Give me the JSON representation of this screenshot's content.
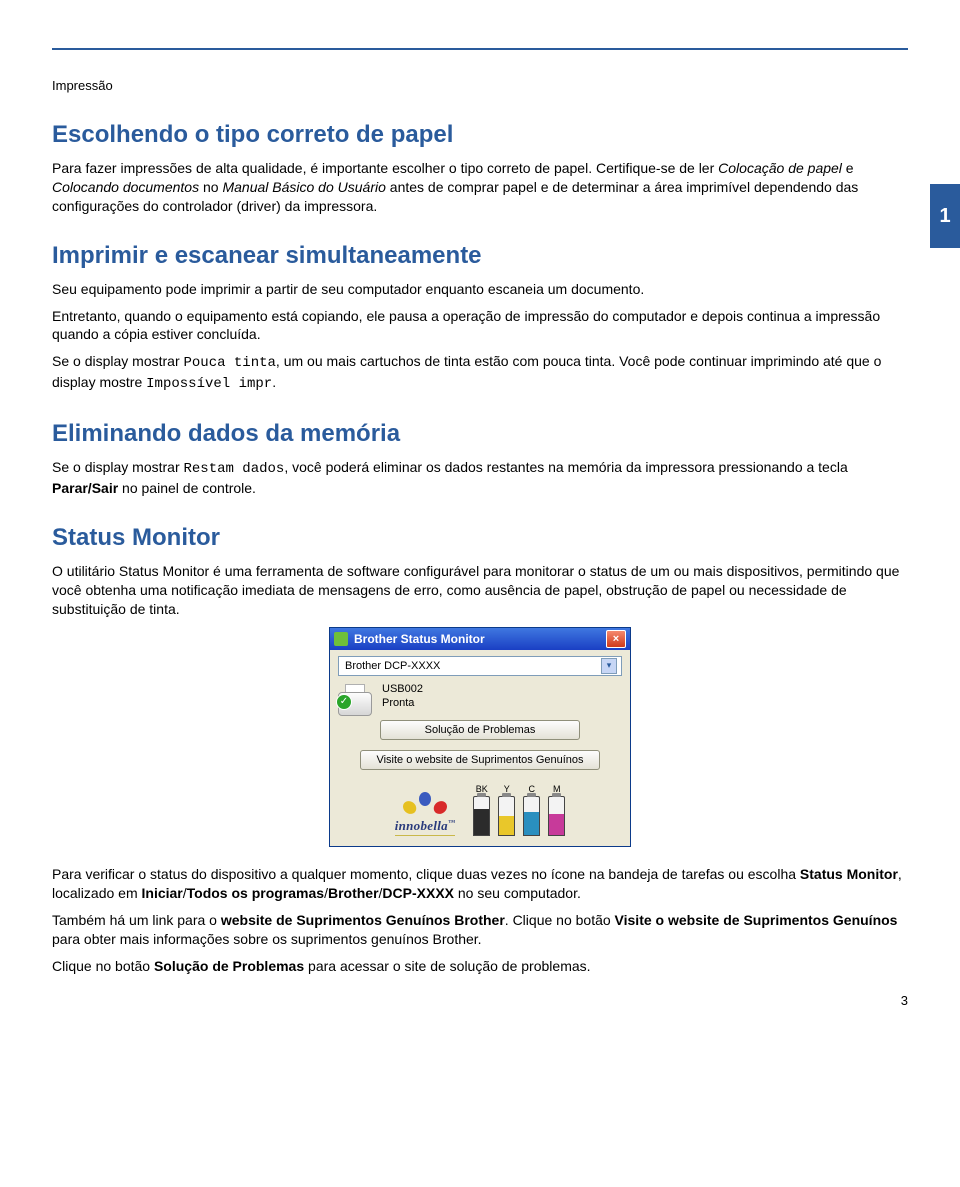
{
  "page": {
    "breadcrumb": "Impressão",
    "chapter_tab": "1",
    "page_number": "3"
  },
  "h1": "Escolhendo o tipo correto de papel",
  "p1a": "Para fazer impressões de alta qualidade, é importante escolher o tipo correto de papel. Certifique-se de ler ",
  "p1b": "Colocação de papel",
  "p1c": " e ",
  "p1d": "Colocando documentos",
  "p1e": " no ",
  "p1f": "Manual Básico do Usuário",
  "p1g": " antes de comprar papel e de determinar a área imprimível dependendo das configurações do controlador (driver) da impressora.",
  "h2": "Imprimir e escanear simultaneamente",
  "p2": "Seu equipamento pode imprimir a partir de seu computador enquanto escaneia um documento.",
  "p3": "Entretanto, quando o equipamento está copiando, ele pausa a operação de impressão do computador e depois continua a impressão quando a cópia estiver concluída.",
  "p4a": "Se o display mostrar ",
  "p4b": "Pouca tinta",
  "p4c": ", um ou mais cartuchos de tinta estão com pouca tinta. Você pode continuar imprimindo até que o display mostre ",
  "p4d": "Impossível impr",
  "p4e": ".",
  "h3": "Eliminando dados da memória",
  "p5a": "Se o display mostrar ",
  "p5b": "Restam dados",
  "p5c": ", você poderá eliminar os dados restantes na memória da impressora pressionando a tecla ",
  "p5d": "Parar/Sair",
  "p5e": " no painel de controle.",
  "h4": "Status Monitor",
  "p6": "O utilitário Status Monitor é uma ferramenta de software configurável para monitorar o status de um ou mais dispositivos, permitindo que você obtenha uma notificação imediata de mensagens de erro, como ausência de papel, obstrução de papel ou necessidade de substituição de tinta.",
  "p7a": "Para verificar o status do dispositivo a qualquer momento, clique duas vezes no ícone na bandeja de tarefas ou escolha ",
  "p7b": "Status Monitor",
  "p7c": ", localizado em ",
  "p7d": "Iniciar",
  "p7e": "/",
  "p7f": "Todos os programas",
  "p7g": "/",
  "p7h": "Brother",
  "p7i": "/",
  "p7j": "DCP-XXXX",
  "p7k": " no seu computador.",
  "p8a": "Também há um link para o ",
  "p8b": "website de Suprimentos Genuínos Brother",
  "p8c": ". Clique no botão ",
  "p8d": "Visite o website de Suprimentos Genuínos",
  "p8e": " para obter mais informações sobre os suprimentos genuínos Brother.",
  "p9a": "Clique no botão ",
  "p9b": "Solução de Problemas",
  "p9c": " para acessar o site de solução de problemas.",
  "sm": {
    "title": "Brother Status Monitor",
    "device": "Brother DCP-XXXX",
    "port": "USB002",
    "status": "Pronta",
    "btn1": "Solução de Problemas",
    "btn2": "Visite o website de Suprimentos Genuínos",
    "ink": {
      "bk": "BK",
      "y": "Y",
      "c": "C",
      "m": "M"
    },
    "logo": "innobella",
    "logo_tm": "™"
  }
}
